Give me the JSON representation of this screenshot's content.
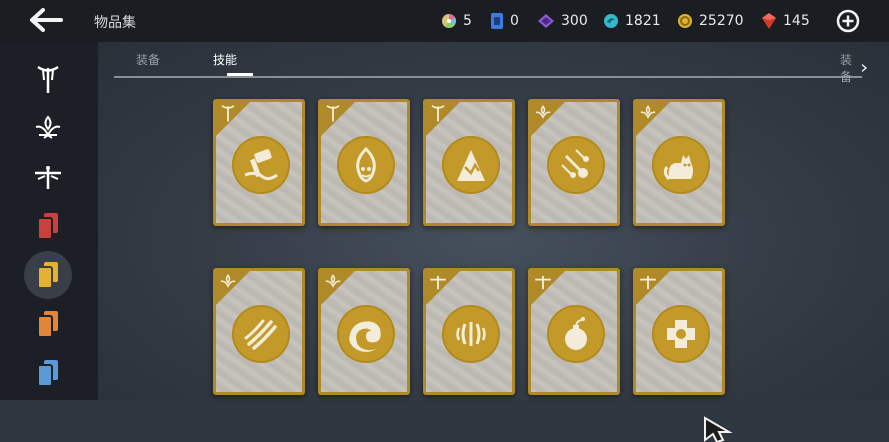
{
  "header": {
    "back_icon": "arrow-left-icon",
    "title": "物品集",
    "currencies": [
      {
        "icon": "color-wheel-icon",
        "value": "5",
        "color": "#d9c27a"
      },
      {
        "icon": "blue-card-icon",
        "value": "0",
        "color": "#3d7be0"
      },
      {
        "icon": "purple-diamond-icon",
        "value": "300",
        "color": "#8d5ad6"
      },
      {
        "icon": "teal-orb-icon",
        "value": "1821",
        "color": "#35b8c9"
      },
      {
        "icon": "gold-coin-icon",
        "value": "25270",
        "color": "#e0b52d"
      },
      {
        "icon": "red-gem-icon",
        "value": "145",
        "color": "#d23a2c"
      }
    ],
    "add_icon": "plus-circle-icon"
  },
  "sidebar": {
    "items": [
      {
        "icon": "sword-emblem-icon",
        "color": "#ffffff",
        "active": false
      },
      {
        "icon": "lotus-emblem-icon",
        "color": "#ffffff",
        "active": false
      },
      {
        "icon": "dragonfly-emblem-icon",
        "color": "#ffffff",
        "active": false
      },
      {
        "icon": "red-cards-icon",
        "color": "#c8413a",
        "active": false
      },
      {
        "icon": "yellow-cards-icon",
        "color": "#e6b12c",
        "active": true
      },
      {
        "icon": "orange-cards-icon",
        "color": "#e0863a",
        "active": false
      },
      {
        "icon": "blue-cards-icon",
        "color": "#5a9ad8",
        "active": false
      }
    ]
  },
  "tabs": {
    "items": [
      {
        "label": "装备",
        "active": false
      },
      {
        "label": "技能",
        "active": true
      }
    ],
    "right_label": "装备"
  },
  "colors": {
    "card_border": "#b08a28",
    "medal": "#c39a2a"
  },
  "cards": [
    {
      "corner_icon": "sword-emblem-icon",
      "skill_icon": "hammer-strike-icon"
    },
    {
      "corner_icon": "sword-emblem-icon",
      "skill_icon": "flame-face-icon"
    },
    {
      "corner_icon": "sword-emblem-icon",
      "skill_icon": "mountain-rise-icon"
    },
    {
      "corner_icon": "lotus-emblem-icon",
      "skill_icon": "meteor-shower-icon"
    },
    {
      "corner_icon": "lotus-emblem-icon",
      "skill_icon": "cat-icon"
    },
    {
      "corner_icon": "lotus-emblem-icon",
      "skill_icon": "claw-slash-icon"
    },
    {
      "corner_icon": "lotus-emblem-icon",
      "skill_icon": "wave-icon"
    },
    {
      "corner_icon": "dragonfly-emblem-icon",
      "skill_icon": "spiky-burst-icon"
    },
    {
      "corner_icon": "dragonfly-emblem-icon",
      "skill_icon": "bomb-icon"
    },
    {
      "corner_icon": "dragonfly-emblem-icon",
      "skill_icon": "medical-cross-icon"
    }
  ]
}
